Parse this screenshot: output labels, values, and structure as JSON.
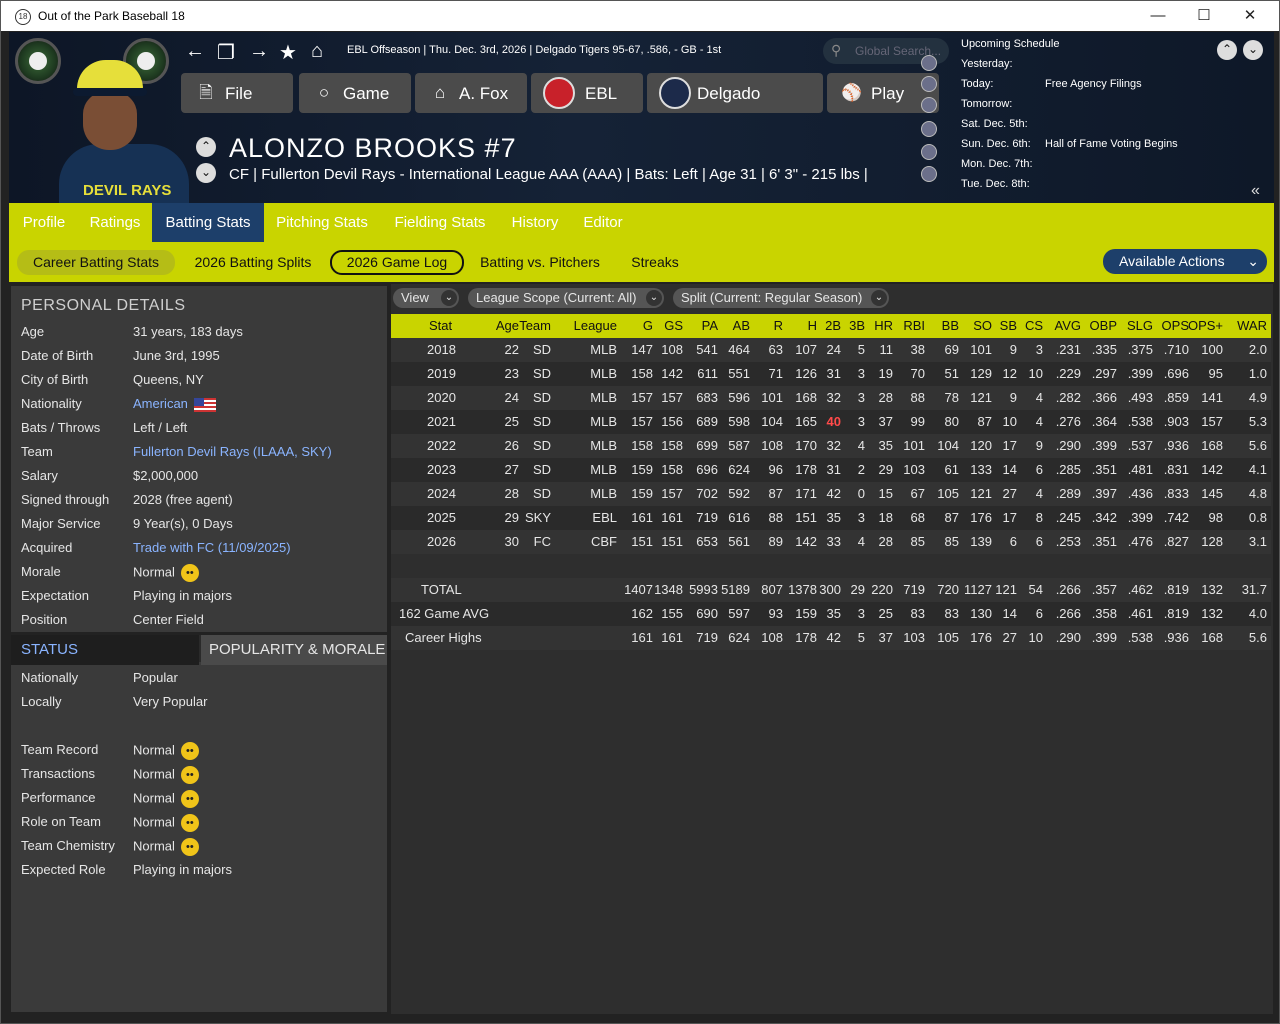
{
  "window": {
    "title": "Out of the Park Baseball 18",
    "app_icon": "18"
  },
  "header": {
    "league_line": "EBL Offseason  |  Thu. Dec. 3rd, 2026  |  Delgado Tigers  95-67, .586, - GB - 1st",
    "search_placeholder": "Global Search...",
    "buttons": [
      {
        "label": "File",
        "icon": "file-icon"
      },
      {
        "label": "Game",
        "icon": "globe-icon"
      },
      {
        "label": "A. Fox",
        "icon": "home-icon"
      },
      {
        "label": "EBL",
        "icon": "league-logo"
      },
      {
        "label": "Delgado",
        "icon": "team-logo"
      },
      {
        "label": "Play",
        "icon": "baseball-icon"
      }
    ],
    "player_name": "ALONZO BROOKS  #7",
    "player_info": "CF | Fullerton Devil Rays - International League AAA (AAA)  |  Bats: Left  |  Age 31  |  6' 3\" - 215 lbs  |",
    "jersey_text": "DEVIL RAYS"
  },
  "schedule": {
    "title": "Upcoming Schedule",
    "rows": [
      {
        "day": "Yesterday:",
        "event": ""
      },
      {
        "day": "Today:",
        "event": "Free Agency Filings"
      },
      {
        "day": "Tomorrow:",
        "event": ""
      },
      {
        "day": "Sat. Dec. 5th:",
        "event": ""
      },
      {
        "day": "Sun. Dec. 6th:",
        "event": "Hall of Fame Voting Begins"
      },
      {
        "day": "Mon. Dec. 7th:",
        "event": ""
      },
      {
        "day": "Tue. Dec. 8th:",
        "event": ""
      }
    ]
  },
  "tabs": [
    "Profile",
    "Ratings",
    "Batting Stats",
    "Pitching Stats",
    "Fielding Stats",
    "History",
    "Editor"
  ],
  "subtabs": [
    "Career Batting Stats",
    "2026 Batting Splits",
    "2026 Game Log",
    "Batting vs. Pitchers",
    "Streaks"
  ],
  "available_actions": "Available Actions",
  "personal": {
    "title": "PERSONAL DETAILS",
    "rows": [
      {
        "k": "Age",
        "v": "31 years, 183 days"
      },
      {
        "k": "Date of Birth",
        "v": "June 3rd, 1995"
      },
      {
        "k": "City of Birth",
        "v": "Queens, NY"
      },
      {
        "k": "Nationality",
        "v": "American"
      },
      {
        "k": "Bats / Throws",
        "v": "Left / Left"
      },
      {
        "k": "Team",
        "v": "Fullerton Devil Rays (ILAAA, SKY)"
      },
      {
        "k": "Salary",
        "v": "$2,000,000"
      },
      {
        "k": "Signed through",
        "v": "2028 (free agent)"
      },
      {
        "k": "Major Service",
        "v": "9 Year(s), 0 Days"
      },
      {
        "k": "Acquired",
        "v": "Trade with FC (11/09/2025)"
      },
      {
        "k": "Morale",
        "v": "Normal"
      },
      {
        "k": "Expectation",
        "v": "Playing in majors"
      },
      {
        "k": "Position",
        "v": "Center Field"
      }
    ]
  },
  "status": {
    "tab_status": "STATUS",
    "tab_pop": "POPULARITY & MORALE",
    "rows": [
      {
        "k": "Nationally",
        "v": "Popular"
      },
      {
        "k": "Locally",
        "v": "Very Popular"
      },
      {
        "k": "Team Record",
        "v": "Normal"
      },
      {
        "k": "Transactions",
        "v": "Normal"
      },
      {
        "k": "Performance",
        "v": "Normal"
      },
      {
        "k": "Role on Team",
        "v": "Normal"
      },
      {
        "k": "Team Chemistry",
        "v": "Normal"
      },
      {
        "k": "Expected Role",
        "v": "Playing in majors"
      }
    ]
  },
  "filters": {
    "view": "View",
    "scope": "League Scope  (Current: All)",
    "split": "Split  (Current: Regular Season)"
  },
  "table": {
    "columns": [
      "Stat",
      "Age",
      "Team",
      "League",
      "G",
      "GS",
      "PA",
      "AB",
      "R",
      "H",
      "2B",
      "3B",
      "HR",
      "RBI",
      "BB",
      "SO",
      "SB",
      "CS",
      "AVG",
      "OBP",
      "SLG",
      "OPS",
      "OPS+",
      "WAR"
    ],
    "rows": [
      [
        "2018",
        "22",
        "SD",
        "MLB",
        "147",
        "108",
        "541",
        "464",
        "63",
        "107",
        "24",
        "5",
        "11",
        "38",
        "69",
        "101",
        "9",
        "3",
        ".231",
        ".335",
        ".375",
        ".710",
        "100",
        "2.0"
      ],
      [
        "2019",
        "23",
        "SD",
        "MLB",
        "158",
        "142",
        "611",
        "551",
        "71",
        "126",
        "31",
        "3",
        "19",
        "70",
        "51",
        "129",
        "12",
        "10",
        ".229",
        ".297",
        ".399",
        ".696",
        "95",
        "1.0"
      ],
      [
        "2020",
        "24",
        "SD",
        "MLB",
        "157",
        "157",
        "683",
        "596",
        "101",
        "168",
        "32",
        "3",
        "28",
        "88",
        "78",
        "121",
        "9",
        "4",
        ".282",
        ".366",
        ".493",
        ".859",
        "141",
        "4.9"
      ],
      [
        "2021",
        "25",
        "SD",
        "MLB",
        "157",
        "156",
        "689",
        "598",
        "104",
        "165",
        "40",
        "3",
        "37",
        "99",
        "80",
        "87",
        "10",
        "4",
        ".276",
        ".364",
        ".538",
        ".903",
        "157",
        "5.3"
      ],
      [
        "2022",
        "26",
        "SD",
        "MLB",
        "158",
        "158",
        "699",
        "587",
        "108",
        "170",
        "32",
        "4",
        "35",
        "101",
        "104",
        "120",
        "17",
        "9",
        ".290",
        ".399",
        ".537",
        ".936",
        "168",
        "5.6"
      ],
      [
        "2023",
        "27",
        "SD",
        "MLB",
        "159",
        "158",
        "696",
        "624",
        "96",
        "178",
        "31",
        "2",
        "29",
        "103",
        "61",
        "133",
        "14",
        "6",
        ".285",
        ".351",
        ".481",
        ".831",
        "142",
        "4.1"
      ],
      [
        "2024",
        "28",
        "SD",
        "MLB",
        "159",
        "157",
        "702",
        "592",
        "87",
        "171",
        "42",
        "0",
        "15",
        "67",
        "105",
        "121",
        "27",
        "4",
        ".289",
        ".397",
        ".436",
        ".833",
        "145",
        "4.8"
      ],
      [
        "2025",
        "29",
        "SKY",
        "EBL",
        "161",
        "161",
        "719",
        "616",
        "88",
        "151",
        "35",
        "3",
        "18",
        "68",
        "87",
        "176",
        "17",
        "8",
        ".245",
        ".342",
        ".399",
        ".742",
        "98",
        "0.8"
      ],
      [
        "2026",
        "30",
        "FC",
        "CBF",
        "151",
        "151",
        "653",
        "561",
        "89",
        "142",
        "33",
        "4",
        "28",
        "85",
        "85",
        "139",
        "6",
        "6",
        ".253",
        ".351",
        ".476",
        ".827",
        "128",
        "3.1"
      ]
    ],
    "totals": [
      [
        "TOTAL",
        "",
        "",
        "",
        "1407",
        "1348",
        "5993",
        "5189",
        "807",
        "1378",
        "300",
        "29",
        "220",
        "719",
        "720",
        "1127",
        "121",
        "54",
        ".266",
        ".357",
        ".462",
        ".819",
        "132",
        "31.7"
      ],
      [
        "162 Game AVG",
        "",
        "",
        "",
        "162",
        "155",
        "690",
        "597",
        "93",
        "159",
        "35",
        "3",
        "25",
        "83",
        "83",
        "130",
        "14",
        "6",
        ".266",
        ".358",
        ".461",
        ".819",
        "132",
        "4.0"
      ],
      [
        "Career Highs",
        "",
        "",
        "",
        "161",
        "161",
        "719",
        "624",
        "108",
        "178",
        "42",
        "5",
        "37",
        "103",
        "105",
        "176",
        "27",
        "10",
        ".290",
        ".399",
        ".538",
        ".936",
        "168",
        "5.6"
      ]
    ],
    "highlight": {
      "row": 3,
      "col": 10,
      "color": "#ff4a4a"
    }
  },
  "colors": {
    "accent": "#c9d400",
    "active_tab": "#1d3f6a",
    "link": "#8ab4ff"
  }
}
